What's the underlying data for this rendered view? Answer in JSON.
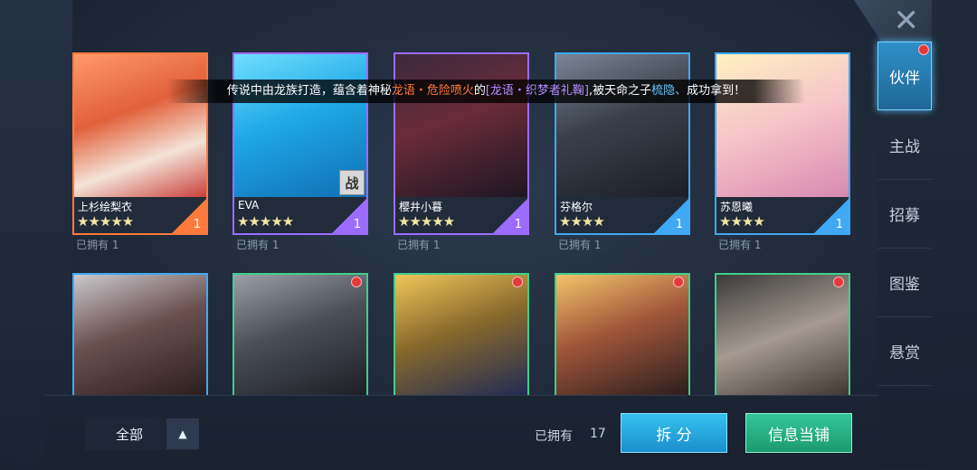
{
  "nav": {
    "close_glyph": "✕",
    "items": [
      {
        "label": "伙伴",
        "active": true,
        "dot": true
      },
      {
        "label": "主战"
      },
      {
        "label": "招募"
      },
      {
        "label": "图鉴"
      },
      {
        "label": "悬赏"
      }
    ]
  },
  "announcement": {
    "p1": "传说中由龙族打造，蕴含着神秘",
    "h1": "龙语・危险喷火",
    "p2": "的",
    "h2": "[龙语・织梦者礼鞠]",
    "p3": ",被天命之子",
    "h3": "梳隐、",
    "p4": "成功拿到！"
  },
  "cards": [
    {
      "name": "上杉绘梨衣",
      "stars": "★★★★★",
      "count": "1",
      "owned": "已拥有  1",
      "rarity": "orange",
      "color": "#ff7a3c"
    },
    {
      "name": "EVA",
      "stars": "★★★★★",
      "count": "1",
      "owned": "已拥有  1",
      "rarity": "purple",
      "color": "#9b6cff",
      "badge": "战"
    },
    {
      "name": "樱井小暮",
      "stars": "★★★★★",
      "count": "1",
      "owned": "已拥有  1",
      "rarity": "purple",
      "color": "#9b6cff"
    },
    {
      "name": "芬格尔",
      "stars": "★★★★",
      "count": "1",
      "owned": "已拥有  1",
      "rarity": "blue",
      "color": "#3fa9f5"
    },
    {
      "name": "苏恩曦",
      "stars": "★★★★",
      "count": "1",
      "owned": "已拥有  1",
      "rarity": "blue",
      "color": "#3fa9f5"
    }
  ],
  "cards_row2": [
    {
      "color": "#3fa9f5",
      "dot": false
    },
    {
      "color": "#3fcf8a",
      "dot": true
    },
    {
      "color": "#3fcf8a",
      "dot": true
    },
    {
      "color": "#3fcf8a",
      "dot": true
    },
    {
      "color": "#3fcf8a",
      "dot": true
    }
  ],
  "bottom": {
    "filter_label": "全部",
    "filter_arrow": "▲",
    "owned_label": "已拥有",
    "owned_count": "17",
    "split_label": "拆 分",
    "pawn_label": "信息当铺"
  }
}
